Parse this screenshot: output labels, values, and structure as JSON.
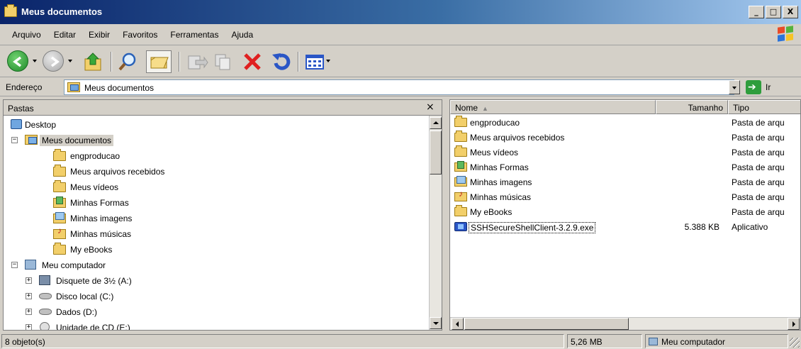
{
  "window": {
    "title": "Meus documentos"
  },
  "window_controls": {
    "minimize": "_",
    "maximize": "□",
    "close": "X"
  },
  "menu": [
    "Arquivo",
    "Editar",
    "Exibir",
    "Favoritos",
    "Ferramentas",
    "Ajuda"
  ],
  "toolbar": {
    "buttons": [
      "back-icon",
      "forward-icon",
      "up-folder-icon",
      "search-icon",
      "folders-icon",
      "move-to-icon",
      "copy-to-icon",
      "delete-icon",
      "undo-icon",
      "views-icon"
    ]
  },
  "address": {
    "label": "Endereço",
    "value": "Meus documentos",
    "go_label": "Ir"
  },
  "folders_pane": {
    "title": "Pastas",
    "close": "×",
    "tree": [
      {
        "label": "Desktop",
        "level": 0,
        "icon": "desktop-icon",
        "toggle": ""
      },
      {
        "label": "Meus documentos",
        "level": 1,
        "icon": "my-documents-icon",
        "toggle": "−",
        "selected": true
      },
      {
        "label": "engproducao",
        "level": 2,
        "icon": "folder-icon",
        "toggle": ""
      },
      {
        "label": "Meus arquivos recebidos",
        "level": 2,
        "icon": "folder-icon",
        "toggle": ""
      },
      {
        "label": "Meus vídeos",
        "level": 2,
        "icon": "folder-icon",
        "toggle": ""
      },
      {
        "label": "Minhas Formas",
        "level": 2,
        "icon": "shapes-folder-icon",
        "toggle": ""
      },
      {
        "label": "Minhas imagens",
        "level": 2,
        "icon": "pictures-folder-icon",
        "toggle": ""
      },
      {
        "label": "Minhas músicas",
        "level": 2,
        "icon": "music-folder-icon",
        "toggle": ""
      },
      {
        "label": "My eBooks",
        "level": 2,
        "icon": "folder-icon",
        "toggle": ""
      },
      {
        "label": "Meu computador",
        "level": 1,
        "icon": "computer-icon",
        "toggle": "−"
      },
      {
        "label": "Disquete de 3½ (A:)",
        "level": 2,
        "icon": "floppy-icon",
        "toggle": "+"
      },
      {
        "label": "Disco local (C:)",
        "level": 2,
        "icon": "hard-disk-icon",
        "toggle": "+"
      },
      {
        "label": "Dados (D:)",
        "level": 2,
        "icon": "hard-disk-icon",
        "toggle": "+"
      },
      {
        "label": "Unidade de CD (E:)",
        "level": 2,
        "icon": "cd-drive-icon",
        "toggle": "+"
      }
    ]
  },
  "file_list": {
    "columns": {
      "name": "Nome",
      "size": "Tamanho",
      "type": "Tipo"
    },
    "sort_indicator": "▲",
    "rows": [
      {
        "name": "engproducao",
        "size": "",
        "type": "Pasta de arqu",
        "icon": "folder-icon"
      },
      {
        "name": "Meus arquivos recebidos",
        "size": "",
        "type": "Pasta de arqu",
        "icon": "folder-icon"
      },
      {
        "name": "Meus vídeos",
        "size": "",
        "type": "Pasta de arqu",
        "icon": "folder-icon"
      },
      {
        "name": "Minhas Formas",
        "size": "",
        "type": "Pasta de arqu",
        "icon": "shapes-folder-icon"
      },
      {
        "name": "Minhas imagens",
        "size": "",
        "type": "Pasta de arqu",
        "icon": "pictures-folder-icon"
      },
      {
        "name": "Minhas músicas",
        "size": "",
        "type": "Pasta de arqu",
        "icon": "music-folder-icon"
      },
      {
        "name": "My eBooks",
        "size": "",
        "type": "Pasta de arqu",
        "icon": "folder-icon"
      },
      {
        "name": "SSHSecureShellClient-3.2.9.exe",
        "size": "5.388 KB",
        "type": "Aplicativo",
        "icon": "setup-exe-icon",
        "focused": true
      }
    ]
  },
  "status": {
    "objects": "8 objeto(s)",
    "size": "5,26 MB",
    "location": "Meu computador"
  }
}
